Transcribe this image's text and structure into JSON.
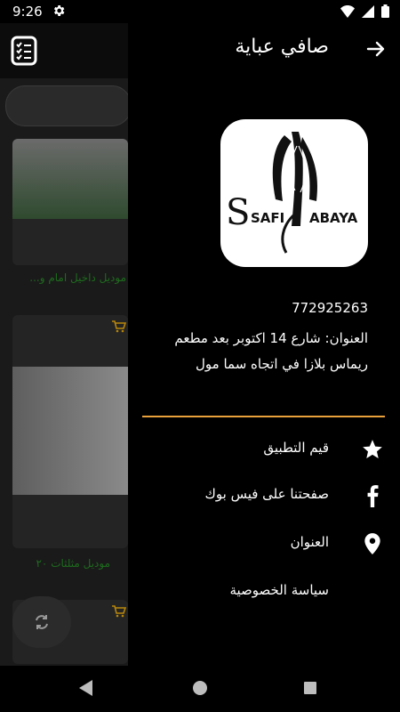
{
  "status_bar": {
    "time": "9:26"
  },
  "background": {
    "cards": [
      {
        "title": "موديل داخيل امام و..."
      },
      {
        "title": "موديل مثلثات ٢٠"
      }
    ]
  },
  "drawer": {
    "title": "صافي عباية",
    "logo_text_left": "SAFI",
    "logo_text_right": "ABAYA",
    "phone": "772925263",
    "address": "العنوان: شارع 14 اكتوبر بعد مطعم ريماس بلازا في اتجاه سما مول",
    "accent_color": "#e8a13b",
    "menu": [
      {
        "label": "قيم التطبيق",
        "icon": "star-icon"
      },
      {
        "label": "صفحتنا على فيس بوك",
        "icon": "facebook-icon"
      },
      {
        "label": "العنوان",
        "icon": "location-pin-icon"
      },
      {
        "label": "سياسة الخصوصية",
        "icon": ""
      }
    ]
  }
}
